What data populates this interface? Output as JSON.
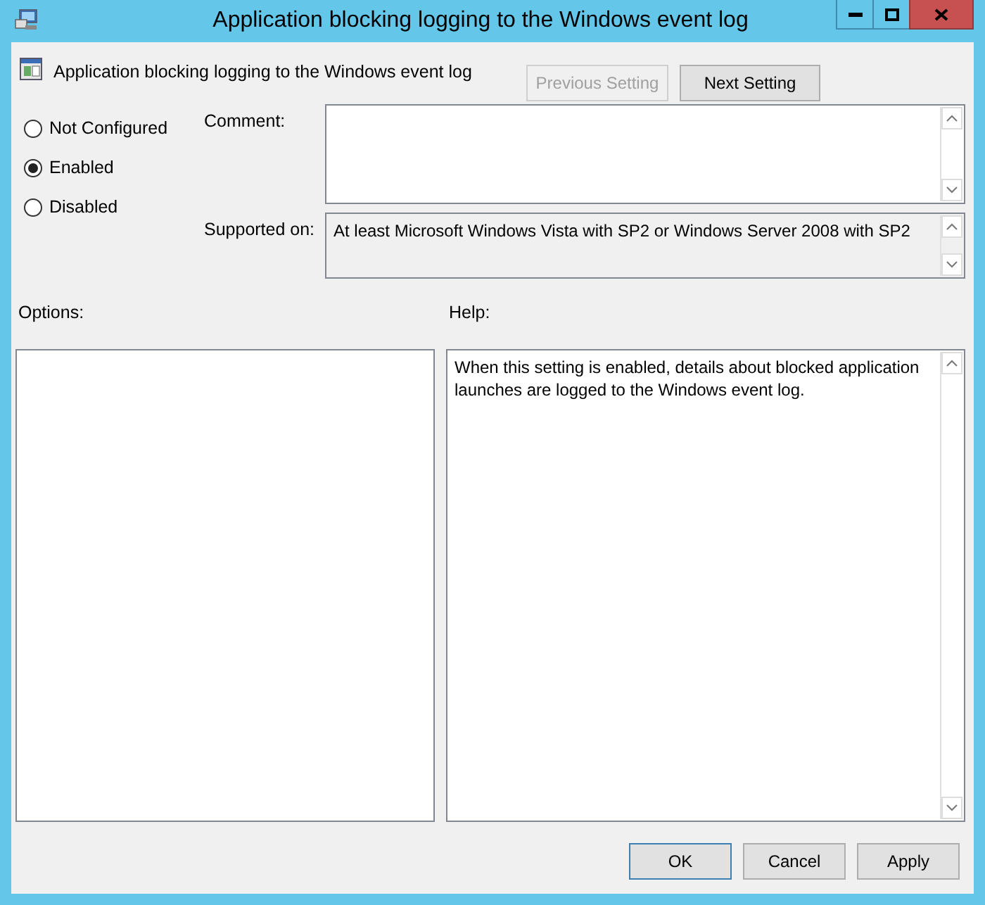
{
  "window": {
    "title": "Application blocking logging to the Windows event log"
  },
  "setting": {
    "title": "Application blocking logging to the Windows event log"
  },
  "nav_buttons": [
    {
      "label": "Previous Setting",
      "disabled": true
    },
    {
      "label": "Next Setting",
      "disabled": false
    }
  ],
  "state_options": [
    {
      "label": "Not Configured",
      "selected": false
    },
    {
      "label": "Enabled",
      "selected": true
    },
    {
      "label": "Disabled",
      "selected": false
    }
  ],
  "comment": {
    "label": "Comment:"
  },
  "supported_on": {
    "label": "Supported on:",
    "value": "At least Microsoft Windows Vista with SP2 or Windows Server 2008 with SP2"
  },
  "options": {
    "label": "Options:"
  },
  "help": {
    "label": "Help:",
    "text": "When this setting is enabled, details about blocked application launches are logged to the Windows event log."
  },
  "buttons": [
    {
      "label": "OK",
      "default": true
    },
    {
      "label": "Cancel",
      "default": false
    },
    {
      "label": "Apply",
      "default": false
    }
  ]
}
